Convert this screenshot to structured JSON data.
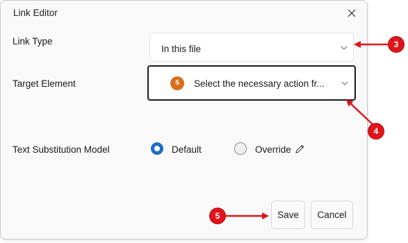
{
  "dialog": {
    "title": "Link Editor",
    "close_icon": "close-icon"
  },
  "link_type": {
    "label": "Link Type",
    "value": "In this file"
  },
  "target_element": {
    "label": "Target Element",
    "badge": "5",
    "value": "Select the necessary action fr..."
  },
  "text_substitution": {
    "label": "Text Substitution Model",
    "options": [
      {
        "label": "Default",
        "selected": true
      },
      {
        "label": "Override",
        "selected": false,
        "icon": "pencil-icon"
      }
    ]
  },
  "buttons": {
    "save": "Save",
    "cancel": "Cancel"
  },
  "callouts": [
    "3",
    "4",
    "5"
  ],
  "colors": {
    "accent": "#1b6fc4",
    "badge": "#d9701f",
    "callout": "#e0141b"
  }
}
